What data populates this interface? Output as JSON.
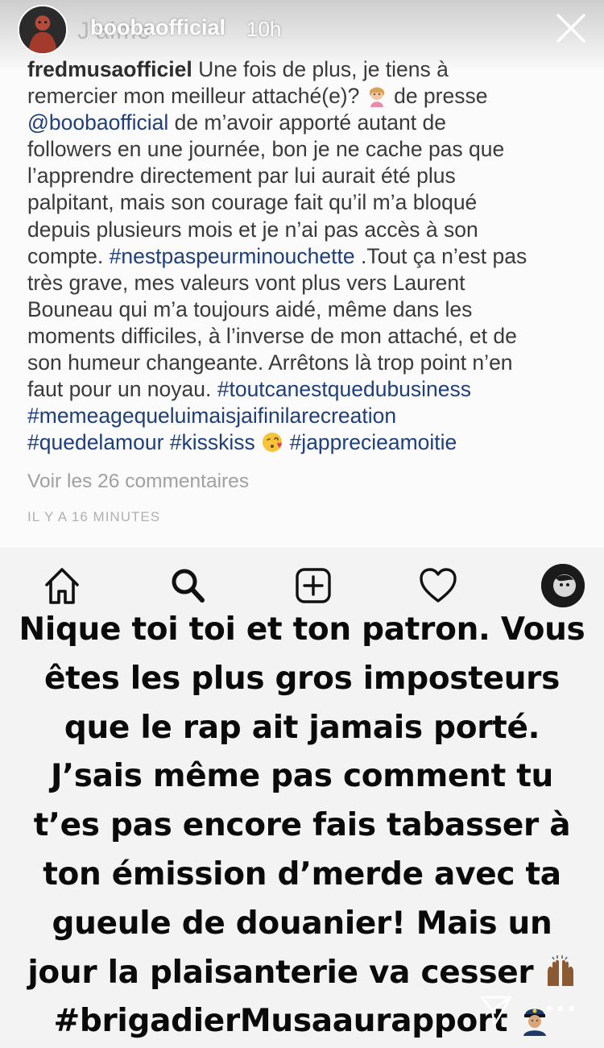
{
  "story": {
    "username": "boobaofficial",
    "time": "10h",
    "faded_label": "J'aime"
  },
  "post": {
    "caption_lines": [
      {
        "segments": [
          {
            "text": "fredmusaofficiel",
            "kind": "user"
          },
          {
            "text": " Une fois de plus, je tiens à",
            "kind": "text"
          }
        ]
      },
      {
        "segments": [
          {
            "text": "remercier mon meilleur attaché(e)? ",
            "kind": "text"
          },
          {
            "emoji": "woman-tipping-hand-emoji"
          },
          {
            "text": " de presse",
            "kind": "text"
          }
        ]
      },
      {
        "segments": [
          {
            "text": "@boobaofficial",
            "kind": "tag"
          },
          {
            "text": " de m’avoir apporté autant de",
            "kind": "text"
          }
        ]
      },
      {
        "segments": [
          {
            "text": "followers en une journée, bon je ne cache pas que",
            "kind": "text"
          }
        ]
      },
      {
        "segments": [
          {
            "text": "l’apprendre directement par lui aurait été plus",
            "kind": "text"
          }
        ]
      },
      {
        "segments": [
          {
            "text": "palpitant, mais son courage fait qu’il m’a bloqué",
            "kind": "text"
          }
        ]
      },
      {
        "segments": [
          {
            "text": "depuis plusieurs mois et je n’ai pas accès à son",
            "kind": "text"
          }
        ]
      },
      {
        "segments": [
          {
            "text": "compte. ",
            "kind": "text"
          },
          {
            "text": "#nestpaspeurminouchette",
            "kind": "tag"
          },
          {
            "text": " .Tout ça n’est pas",
            "kind": "text"
          }
        ]
      },
      {
        "segments": [
          {
            "text": "très grave, mes valeurs vont plus vers Laurent",
            "kind": "text"
          }
        ]
      },
      {
        "segments": [
          {
            "text": "Bouneau qui m’a toujours aidé, même dans les",
            "kind": "text"
          }
        ]
      },
      {
        "segments": [
          {
            "text": "moments difficiles, à l’inverse de mon attaché, et de",
            "kind": "text"
          }
        ]
      },
      {
        "segments": [
          {
            "text": "son humeur changeante. Arrêtons là trop point n’en",
            "kind": "text"
          }
        ]
      },
      {
        "segments": [
          {
            "text": "faut pour un noyau. ",
            "kind": "text"
          },
          {
            "text": "#toutcanestquedubusiness",
            "kind": "tag"
          }
        ]
      },
      {
        "segments": [
          {
            "text": "#memeagequeluimaisjaifinilarecreation",
            "kind": "tag"
          }
        ]
      },
      {
        "segments": [
          {
            "text": "#quedelamour #kisskiss",
            "kind": "tag"
          },
          {
            "text": " ",
            "kind": "text"
          },
          {
            "emoji": "face-blowing-kiss-emoji"
          },
          {
            "text": " ",
            "kind": "text"
          },
          {
            "text": "#japprecieamoitie",
            "kind": "tag"
          }
        ]
      }
    ],
    "view_comments": "Voir les 26 commentaires",
    "timestamp": "IL Y A 16 MINUTES"
  },
  "overlay": {
    "lines": [
      {
        "segments": [
          {
            "text": "Nique toi toi et ton patron. Vous"
          }
        ]
      },
      {
        "segments": [
          {
            "text": "êtes les plus gros imposteurs"
          }
        ]
      },
      {
        "segments": [
          {
            "text": "que le rap ait jamais porté."
          }
        ]
      },
      {
        "segments": [
          {
            "text": "J’sais même pas comment tu"
          }
        ]
      },
      {
        "segments": [
          {
            "text": "t’es pas encore fais tabasser à"
          }
        ]
      },
      {
        "segments": [
          {
            "text": "ton émission d’merde avec ta"
          }
        ]
      },
      {
        "segments": [
          {
            "text": "gueule de douanier! Mais un"
          }
        ]
      },
      {
        "segments": [
          {
            "text": "jour la plaisanterie va cesser "
          },
          {
            "emoji": "raising-hands-emoji"
          }
        ]
      },
      {
        "segments": [
          {
            "text": "#brigadierMusaaurapport "
          },
          {
            "emoji": "police-officer-emoji"
          }
        ]
      }
    ]
  },
  "nav": {
    "items": [
      "home-icon",
      "search-icon",
      "new-post-icon",
      "heart-icon",
      "profile-avatar-icon"
    ]
  },
  "colors": {
    "caption_text": "#3a3a3a",
    "hashtag": "#1f3f7a",
    "muted": "#a0a0a0",
    "overlay_text": "#0a0a0a"
  }
}
